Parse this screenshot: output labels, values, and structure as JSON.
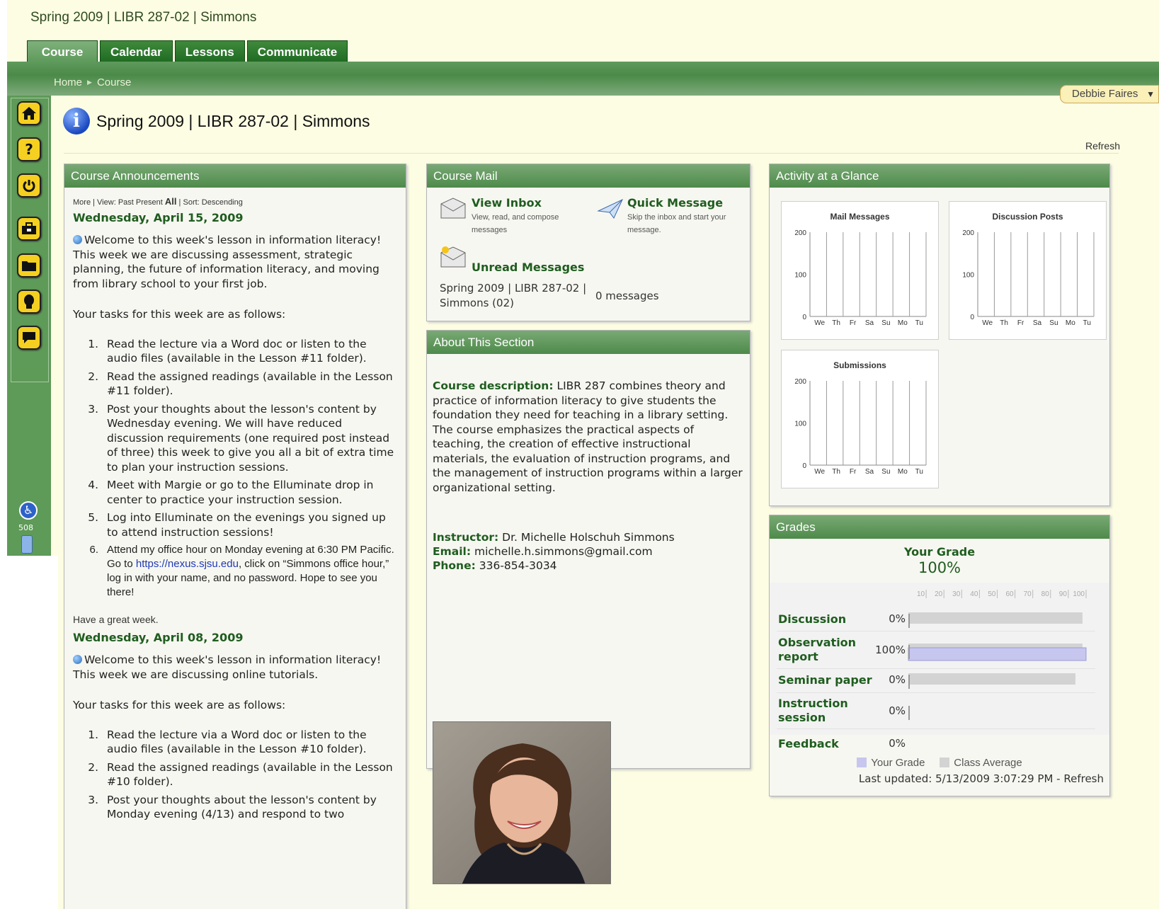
{
  "header": {
    "title": "Spring 2009 | LIBR 287-02 | Simmons",
    "tabs": [
      {
        "label": "Course",
        "active": true
      },
      {
        "label": "Calendar",
        "active": false
      },
      {
        "label": "Lessons",
        "active": false
      },
      {
        "label": "Communicate",
        "active": false
      }
    ],
    "breadcrumb": [
      "Home",
      "Course"
    ],
    "user_name": "Debbie Faires"
  },
  "sidebar": {
    "icons": [
      "home-icon",
      "help-icon",
      "power-icon",
      "briefcase-icon",
      "folder-icon",
      "user-icon",
      "chat-icon"
    ],
    "accessibility_number": "508"
  },
  "page": {
    "title": "Spring 2009 | LIBR 287-02 | Simmons",
    "refresh": "Refresh"
  },
  "announcements": {
    "header": "Course Announcements",
    "meta": {
      "more": "More",
      "view": "View:",
      "past": "Past",
      "present": "Present",
      "all": "All",
      "sort": "Sort: Descending"
    },
    "items": [
      {
        "date": "Wednesday, April 15, 2009",
        "intro": "Welcome to this week's lesson in information literacy! This week we are discussing assessment, strategic planning, the future of information literacy, and moving from library school to your first job.",
        "tasks_intro": "Your tasks for this week are as follows:",
        "tasks": [
          "Read the lecture via a Word doc  or listen to the audio files (available in the Lesson #11 folder).",
          "Read the assigned readings (available in the Lesson #11 folder).",
          "Post your thoughts about the lesson's content by Wednesday evening.  We will have reduced discussion requirements (one required post instead of three) this week to give you all a bit of extra time to plan your instruction sessions.",
          "Meet with Margie or go to the Elluminate drop in center to practice your instruction session.",
          "Log into Elluminate on the evenings you signed up to attend instruction sessions!"
        ],
        "task6_before": "Attend my office hour on Monday evening at 6:30 PM Pacific. Go to ",
        "task6_link": "https://nexus.sjsu.edu",
        "task6_after": ", click on “Simmons office hour,” log in with your name, and no password. Hope to see you there!",
        "closing": "Have a great week."
      },
      {
        "date": "Wednesday, April 08, 2009",
        "intro": "Welcome to this week's lesson in information literacy! This week we are discussing online tutorials.",
        "tasks_intro": "Your tasks for this week are as follows:",
        "tasks": [
          "Read the lecture via a Word doc  or listen to the audio files (available in the Lesson #10 folder).",
          "Read the assigned readings (available in the Lesson #10 folder).",
          "Post your thoughts about the lesson's content by Monday evening (4/13) and respond to two"
        ]
      }
    ]
  },
  "mail": {
    "header": "Course Mail",
    "view_inbox": "View Inbox",
    "view_inbox_desc": "View, read, and compose messages",
    "quick_message": "Quick Message",
    "quick_message_desc": "Skip the inbox and start your message.",
    "unread": "Unread Messages",
    "section": "Spring 2009 | LIBR 287-02 | Simmons (02)",
    "count": "0 messages"
  },
  "about": {
    "header": "About This Section",
    "desc_label": "Course description:",
    "desc": "LIBR 287 combines theory and practice of information literacy to give students the foundation they need for teaching in a library setting. The course emphasizes the practical aspects of teaching, the creation of effective instructional materials, the evaluation of instruction programs, and the management of instruction programs within a larger organizational setting.",
    "instructor_label": "Instructor:",
    "instructor": "Dr. Michelle Holschuh Simmons",
    "email_label": "Email:",
    "email": "michelle.h.simmons@gmail.com",
    "phone_label": "Phone:",
    "phone": "336-854-3034"
  },
  "activity": {
    "header": "Activity at a Glance",
    "charts": [
      {
        "title": "Mail Messages"
      },
      {
        "title": "Discussion Posts"
      },
      {
        "title": "Submissions"
      }
    ]
  },
  "chart_data": [
    {
      "type": "bar",
      "title": "Mail Messages",
      "categories": [
        "We",
        "Th",
        "Fr",
        "Sa",
        "Su",
        "Mo",
        "Tu"
      ],
      "values": [
        0,
        0,
        0,
        0,
        0,
        0,
        0
      ],
      "y_ticks": [
        "200",
        "100",
        "0"
      ],
      "ylim": [
        0,
        200
      ]
    },
    {
      "type": "bar",
      "title": "Discussion Posts",
      "categories": [
        "We",
        "Th",
        "Fr",
        "Sa",
        "Su",
        "Mo",
        "Tu"
      ],
      "values": [
        0,
        0,
        0,
        0,
        0,
        0,
        0
      ],
      "y_ticks": [
        "200",
        "100",
        "0"
      ],
      "ylim": [
        0,
        200
      ]
    },
    {
      "type": "bar",
      "title": "Submissions",
      "categories": [
        "We",
        "Th",
        "Fr",
        "Sa",
        "Su",
        "Mo",
        "Tu"
      ],
      "values": [
        0,
        0,
        0,
        0,
        0,
        0,
        0
      ],
      "y_ticks": [
        "200",
        "100",
        "0"
      ],
      "ylim": [
        0,
        200
      ]
    },
    {
      "type": "bar",
      "title": "Your Grade",
      "overall": "100%",
      "x_ticks": [
        "10",
        "20",
        "30",
        "40",
        "50",
        "60",
        "70",
        "80",
        "90",
        "100"
      ],
      "xlim": [
        0,
        100
      ],
      "categories": [
        "Discussion",
        "Observation report",
        "Seminar paper",
        "Instruction session",
        "Feedback"
      ],
      "pct_labels": [
        "0%",
        "100%",
        "0%",
        "0%",
        "0%"
      ],
      "series": [
        {
          "name": "Your Grade",
          "values": [
            0,
            100,
            0,
            0,
            0
          ],
          "color": "#c6c6ee"
        },
        {
          "name": "Class Average",
          "values": [
            98,
            98,
            94,
            0,
            0
          ],
          "color": "#d3d3d3"
        }
      ]
    }
  ],
  "grades": {
    "header": "Grades",
    "your_grade_label": "Your Grade",
    "overall": "100%",
    "rows": [
      {
        "label": "Discussion",
        "pct": "0%"
      },
      {
        "label": "Observation report",
        "pct": "100%"
      },
      {
        "label": "Seminar paper",
        "pct": "0%"
      },
      {
        "label": "Instruction session",
        "pct": "0%"
      },
      {
        "label": "Feedback",
        "pct": "0%"
      }
    ],
    "legend_your": "Your Grade",
    "legend_avg": "Class Average",
    "updated": "Last updated: 5/13/2009 3:07:29 PM",
    "refresh": "Refresh",
    "updated_sep": " - "
  }
}
